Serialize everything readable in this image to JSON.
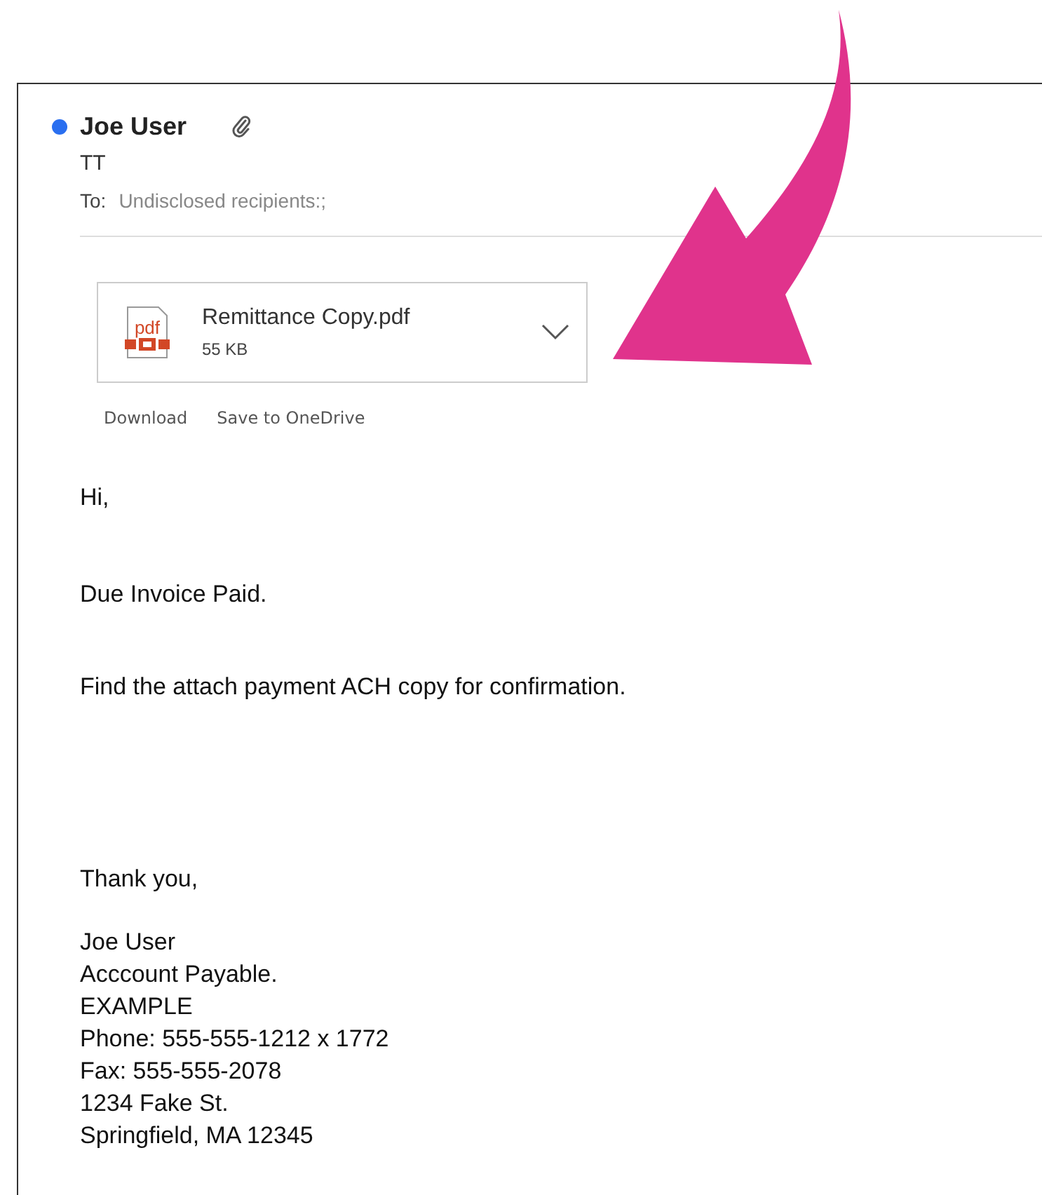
{
  "message": {
    "sender": "Joe User",
    "unread": true,
    "has_attachment": true,
    "subject": "TT",
    "to_label": "To:",
    "recipients": "Undisclosed recipients:;"
  },
  "attachment": {
    "icon_label": "pdf",
    "name": "Remittance Copy.pdf",
    "size": "55 KB"
  },
  "attachment_actions": [
    "Download",
    "Save to OneDrive"
  ],
  "body": [
    [
      "Hi,"
    ],
    [
      "Due Invoice Paid."
    ],
    [
      "Find the attach payment ACH copy for confirmation."
    ],
    [
      "Thank you,"
    ],
    [
      "Joe User",
      "Acccount Payable.",
      "EXAMPLE",
      "Phone: 555-555-1212 x 1772",
      "Fax: 555-555-2078",
      "1234 Fake St.",
      "Springfield, MA 12345"
    ]
  ]
}
